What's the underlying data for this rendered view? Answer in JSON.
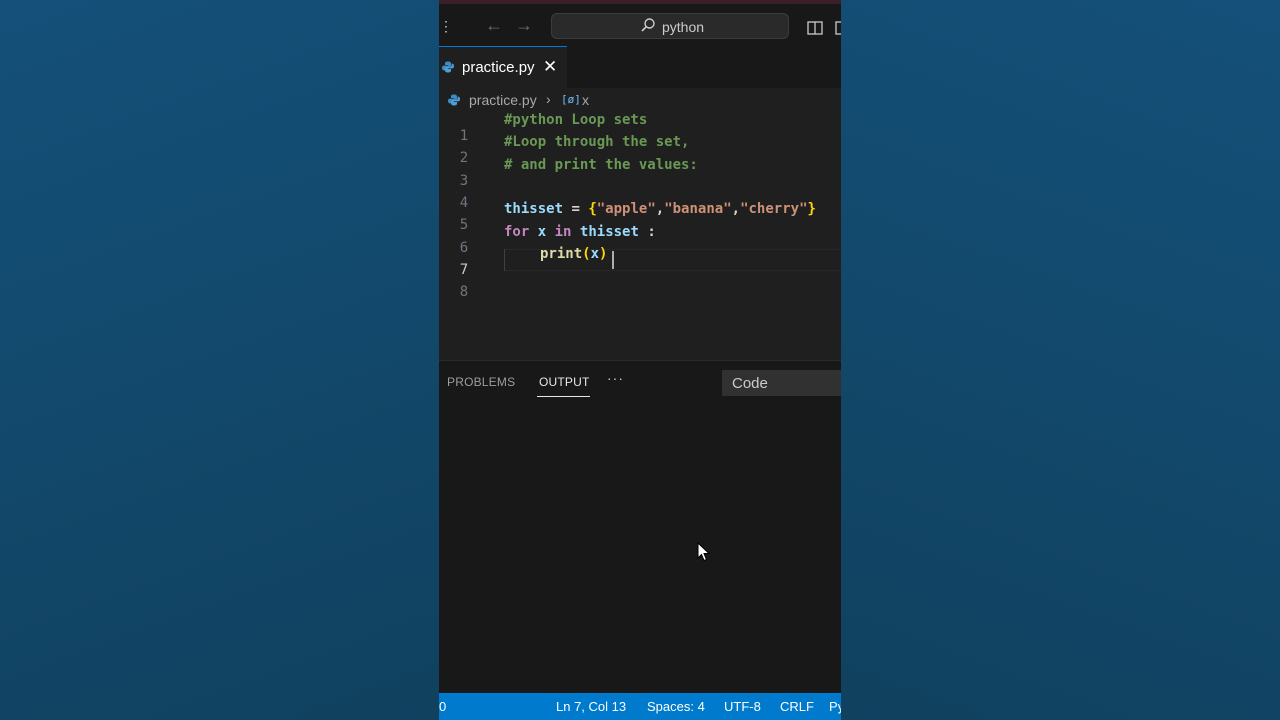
{
  "search": {
    "text": "python"
  },
  "tab": {
    "label": "practice.py",
    "close": "✕"
  },
  "breadcrumb": {
    "file": "practice.py",
    "symbol_icon": "[ø]",
    "symbol": "x"
  },
  "editor": {
    "lines": [
      {
        "num": "1",
        "text": "#python Loop sets"
      },
      {
        "num": "2",
        "text": "#Loop through the set,"
      },
      {
        "num": "3",
        "text": "# and print the values:"
      },
      {
        "num": "4",
        "text": ""
      },
      {
        "num": "5",
        "tokens": [
          "thisset",
          " = ",
          "{",
          "\"apple\"",
          ",",
          "\"banana\"",
          ",",
          "\"cherry\"",
          "}"
        ]
      },
      {
        "num": "6",
        "tokens": [
          "for",
          " ",
          "x",
          " ",
          "in",
          " ",
          "thisset",
          " :"
        ]
      },
      {
        "num": "7",
        "tokens": [
          "print",
          "(",
          "x",
          ")"
        ]
      },
      {
        "num": "8",
        "text": ""
      }
    ],
    "active_line": 7
  },
  "panel": {
    "tabs": [
      "PROBLEMS",
      "OUTPUT"
    ],
    "active_tab": "OUTPUT",
    "more": "···",
    "channel": "Code"
  },
  "statusbar": {
    "left": "0",
    "position": "Ln 7, Col 13",
    "spaces": "Spaces: 4",
    "encoding": "UTF-8",
    "eol": "CRLF",
    "language": "Py"
  },
  "colors": {
    "comment": "#6a9955",
    "keyword": "#c586c0",
    "variable": "#9cdcfe",
    "string": "#ce9178",
    "brace": "#ffd700",
    "function": "#dcdcaa",
    "statusbar": "#007acc"
  }
}
